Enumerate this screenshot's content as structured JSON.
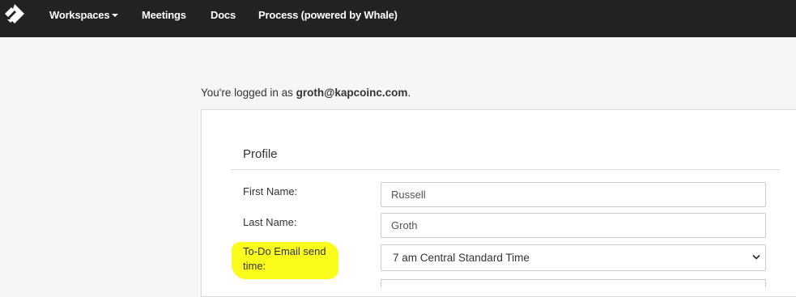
{
  "nav": {
    "items": [
      {
        "label": "Workspaces",
        "dropdown": true
      },
      {
        "label": "Meetings"
      },
      {
        "label": "Docs"
      },
      {
        "label": "Process (powered by Whale)"
      }
    ]
  },
  "session": {
    "prefix": "You're logged in as ",
    "email": "groth@kapcoinc.com",
    "suffix": "."
  },
  "profile": {
    "title": "Profile",
    "first_name_label": "First Name:",
    "first_name_value": "Russell",
    "last_name_label": "Last Name:",
    "last_name_value": "Groth",
    "todo_email_label": "To-Do Email send time:",
    "todo_email_selected": "7 am Central Standard Time"
  },
  "colors": {
    "nav_bg": "#222222",
    "highlight": "#fbfb1c"
  }
}
